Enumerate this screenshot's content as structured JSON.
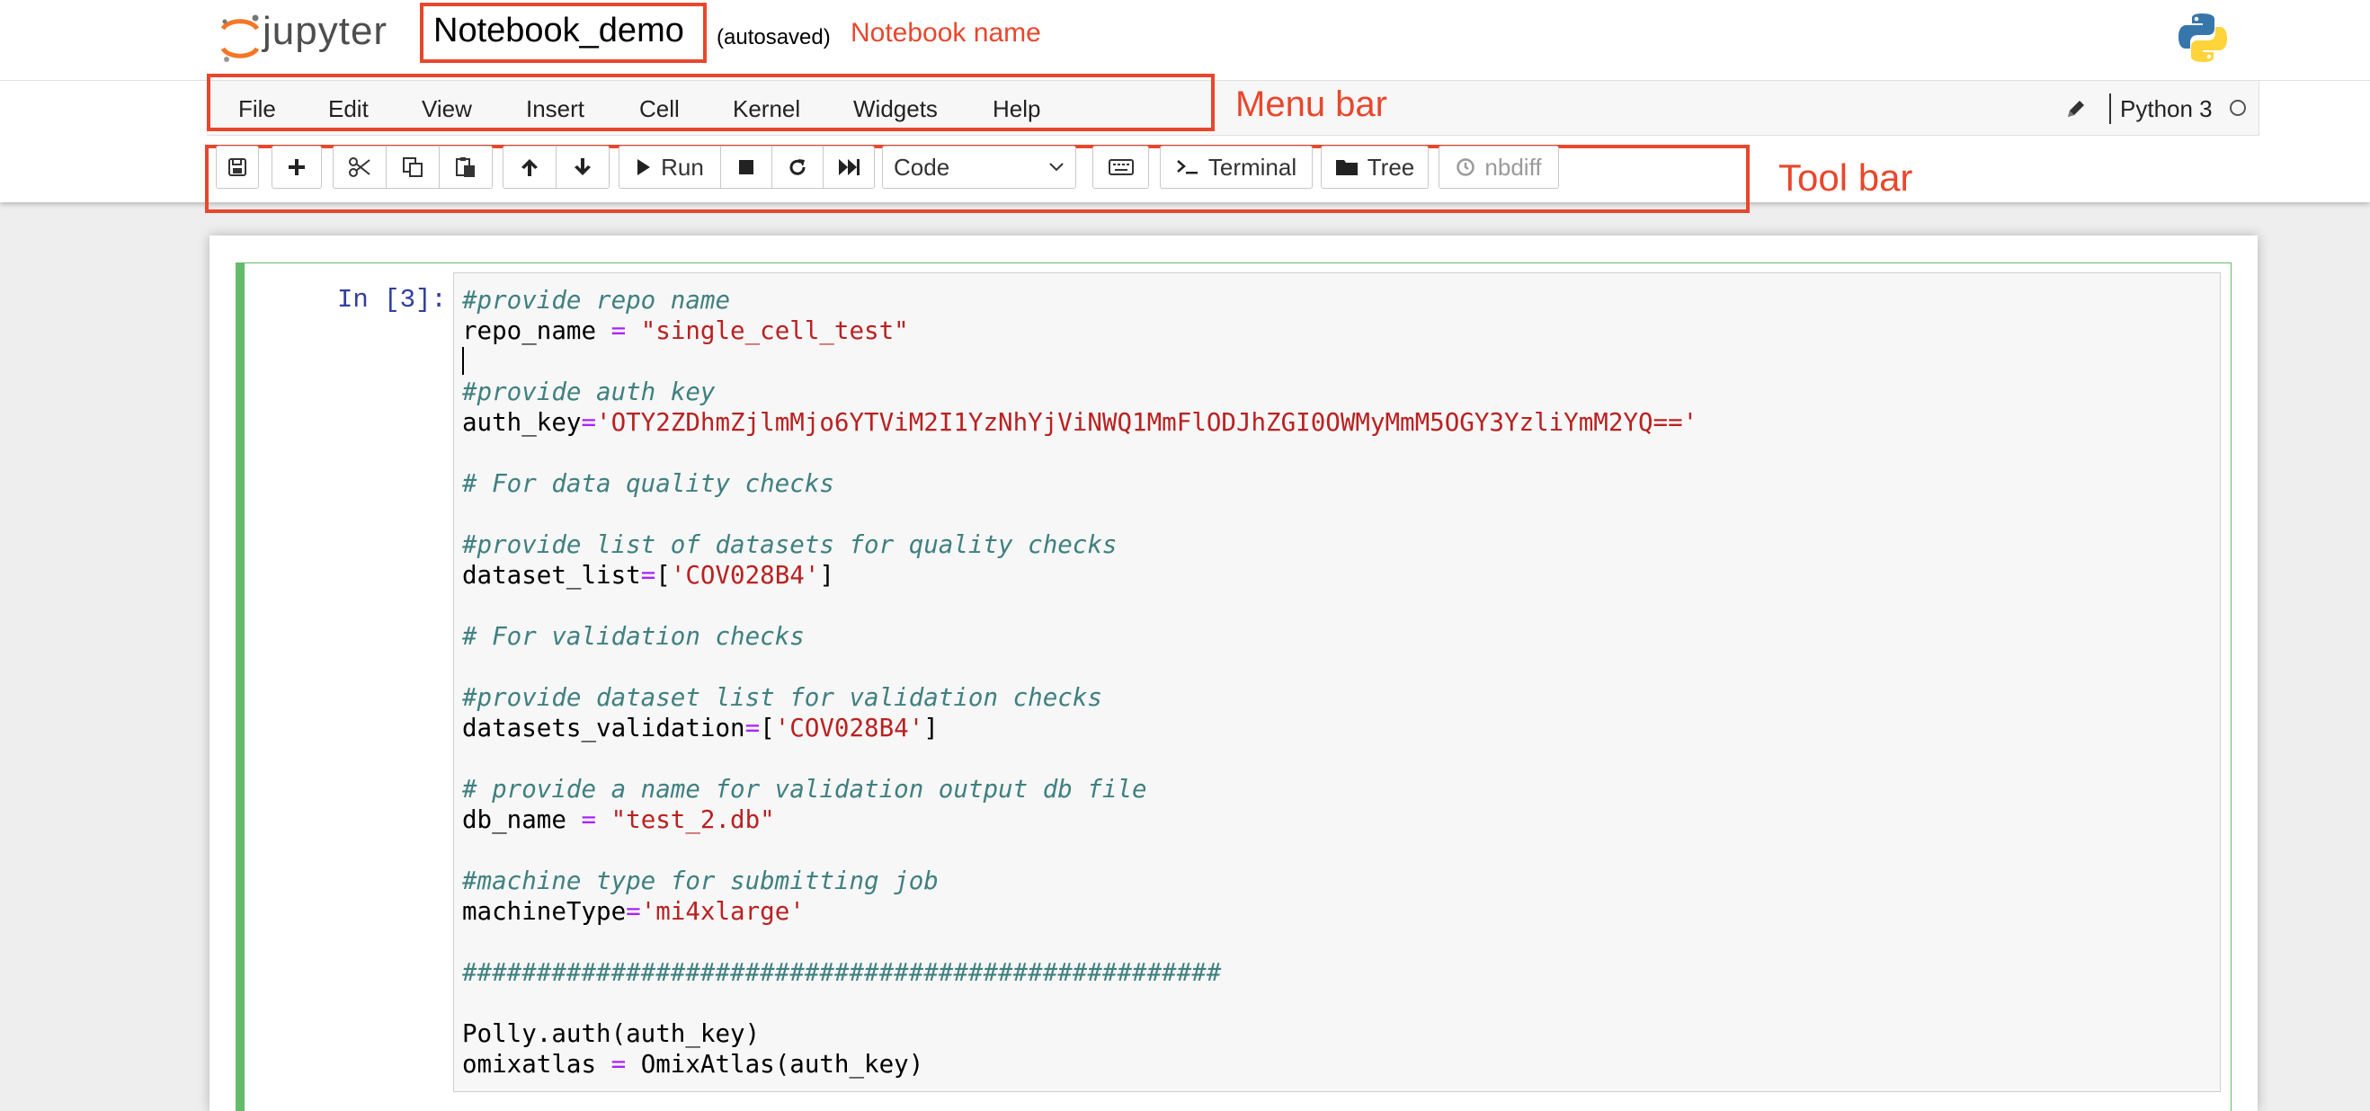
{
  "header": {
    "logo_text": "jupyter",
    "notebook_name": "Notebook_demo",
    "autosave_status": "(autosaved)"
  },
  "annotations": {
    "notebook_name": "Notebook name",
    "menu_bar": "Menu bar",
    "tool_bar": "Tool bar",
    "color": "#e8472c"
  },
  "menu": {
    "items": [
      "File",
      "Edit",
      "View",
      "Insert",
      "Cell",
      "Kernel",
      "Widgets",
      "Help"
    ],
    "kernel_name": "Python 3"
  },
  "toolbar": {
    "run_label": "Run",
    "cell_type": "Code",
    "cell_type_options": [
      "Code"
    ],
    "terminal_label": "Terminal",
    "tree_label": "Tree",
    "nbdiff_label": "nbdiff",
    "icons": [
      "save-icon",
      "plus-icon",
      "cut-icon",
      "copy-icon",
      "paste-icon",
      "arrow-up-icon",
      "arrow-down-icon",
      "play-icon",
      "stop-icon",
      "restart-icon",
      "fast-forward-icon",
      "keyboard-icon",
      "terminal-icon",
      "folder-icon",
      "clock-icon"
    ]
  },
  "cell": {
    "prompt": "In [3]:",
    "lines": [
      [
        {
          "t": "#provide repo name",
          "c": "comment"
        }
      ],
      [
        {
          "t": "repo_name ",
          "c": "plain"
        },
        {
          "t": "=",
          "c": "op"
        },
        {
          "t": " ",
          "c": "plain"
        },
        {
          "t": "\"single_cell_test\"",
          "c": "str"
        }
      ],
      [
        {
          "t": "",
          "c": "plain"
        }
      ],
      [
        {
          "t": "#provide auth key",
          "c": "comment"
        }
      ],
      [
        {
          "t": "auth_key",
          "c": "plain"
        },
        {
          "t": "=",
          "c": "op"
        },
        {
          "t": "'OTY2ZDhmZjlmMjo6YTViM2I1YzNhYjViNWQ1MmFlODJhZGI0OWMyMmM5OGY3YzliYmM2YQ=='",
          "c": "str"
        }
      ],
      [
        {
          "t": "",
          "c": "plain"
        }
      ],
      [
        {
          "t": "# For data quality checks",
          "c": "comment"
        }
      ],
      [
        {
          "t": "",
          "c": "plain"
        }
      ],
      [
        {
          "t": "#provide list of datasets for quality checks",
          "c": "comment"
        }
      ],
      [
        {
          "t": "dataset_list",
          "c": "plain"
        },
        {
          "t": "=",
          "c": "op"
        },
        {
          "t": "[",
          "c": "plain"
        },
        {
          "t": "'COV028B4'",
          "c": "str"
        },
        {
          "t": "]",
          "c": "plain"
        }
      ],
      [
        {
          "t": "",
          "c": "plain"
        }
      ],
      [
        {
          "t": "# For validation checks",
          "c": "comment"
        }
      ],
      [
        {
          "t": "",
          "c": "plain"
        }
      ],
      [
        {
          "t": "#provide dataset list for validation checks",
          "c": "comment"
        }
      ],
      [
        {
          "t": "datasets_validation",
          "c": "plain"
        },
        {
          "t": "=",
          "c": "op"
        },
        {
          "t": "[",
          "c": "plain"
        },
        {
          "t": "'COV028B4'",
          "c": "str"
        },
        {
          "t": "]",
          "c": "plain"
        }
      ],
      [
        {
          "t": "",
          "c": "plain"
        }
      ],
      [
        {
          "t": "# provide a name for validation output db file",
          "c": "comment"
        }
      ],
      [
        {
          "t": "db_name ",
          "c": "plain"
        },
        {
          "t": "=",
          "c": "op"
        },
        {
          "t": " ",
          "c": "plain"
        },
        {
          "t": "\"test_2.db\"",
          "c": "str"
        }
      ],
      [
        {
          "t": "",
          "c": "plain"
        }
      ],
      [
        {
          "t": "#machine type for submitting job",
          "c": "comment"
        }
      ],
      [
        {
          "t": "machineType",
          "c": "plain"
        },
        {
          "t": "=",
          "c": "op"
        },
        {
          "t": "'mi4xlarge'",
          "c": "str"
        }
      ],
      [
        {
          "t": "",
          "c": "plain"
        }
      ],
      [
        {
          "t": "###################################################",
          "c": "comment"
        }
      ],
      [
        {
          "t": "",
          "c": "plain"
        }
      ],
      [
        {
          "t": "Polly.auth(auth_key)",
          "c": "plain"
        }
      ],
      [
        {
          "t": "omixatlas ",
          "c": "plain"
        },
        {
          "t": "=",
          "c": "op"
        },
        {
          "t": " OmixAtlas(auth_key)",
          "c": "plain"
        }
      ]
    ]
  }
}
